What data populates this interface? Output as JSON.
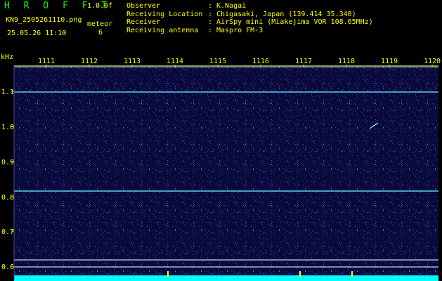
{
  "header": {
    "app_title": "H R O F F T",
    "version": "1.0.0f",
    "filename": "KN9_2505261110.png",
    "meteor_label": "meteor",
    "meteor_count": "6",
    "datetime": "25.05.26 11:10"
  },
  "info": [
    {
      "key": "Observer",
      "sep": ":",
      "value": "K.Nagai"
    },
    {
      "key": "Receiving Location",
      "sep": ":",
      "value": "Chigasaki, Japan (139.414 35.340)"
    },
    {
      "key": "Receiver",
      "sep": ":",
      "value": "AirSpy mini (Miakejima VOR 108.65MHz)"
    },
    {
      "key": "Receiving antenna",
      "sep": ":",
      "value": "Maspro FM-3"
    }
  ],
  "axes": {
    "y_unit": "kHz",
    "x_ticks": [
      "1111",
      "1112",
      "1113",
      "1114",
      "1115",
      "1116",
      "1117",
      "1118",
      "1119",
      "1120"
    ],
    "y_ticks": [
      "1.1",
      "1.0",
      "0.9",
      "0.8",
      "0.7",
      "0.6"
    ]
  },
  "colors": {
    "background": "#0a0a3a",
    "noise": "#2030c0",
    "header_text": "#ffff00",
    "title": "#00ff00",
    "signal_line": "#60e0ff",
    "baseline": "#00ffff",
    "white_line": "#ffffff"
  }
}
